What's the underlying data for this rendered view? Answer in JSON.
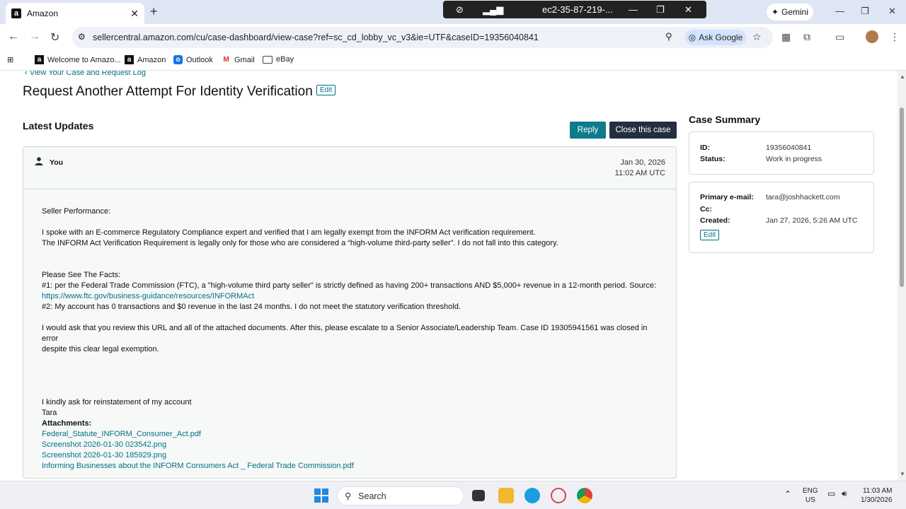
{
  "browser": {
    "tab_title": "Amazon",
    "tab_close": "✕",
    "new_tab": "+",
    "rdp_title": "ec2-35-87-219-...",
    "gemini_label": "Gemini",
    "url": "sellercentral.amazon.com/cu/case-dashboard/view-case?ref=sc_cd_lobby_vc_v3&ie=UTF&caseID=19356040841",
    "ask_google": "Ask Google"
  },
  "bookmarks": [
    {
      "label": "Welcome to Amazo...",
      "icon": "amazon-icon"
    },
    {
      "label": "Amazon",
      "icon": "amazon-icon"
    },
    {
      "label": "Outlook",
      "icon": "outlook-icon"
    },
    {
      "label": "Gmail",
      "icon": "gmail-icon"
    },
    {
      "label": "eBay",
      "icon": "folder-icon"
    }
  ],
  "page": {
    "back_link": "‹ View Your Case and Request Log",
    "title": "Request Another Attempt For Identity Verification",
    "edit_label": "Edit",
    "latest_updates": "Latest Updates",
    "reply_label": "Reply",
    "close_case_label": "Close this case"
  },
  "message": {
    "sender": "You",
    "date": "Jan 30, 2026",
    "time": "11:02 AM UTC",
    "lines": {
      "l1": "Seller Performance:",
      "l2": "I spoke with an E-commerce Regulatory Compliance expert and verified that I am legally exempt from the INFORM Act verification requirement.",
      "l3": "The INFORM Act Verification Requirement is legally only for those who are considered a “high-volume third-party seller”. I do not fall into this category.",
      "l4": "Please See The Facts:",
      "l5": "#1: per the Federal Trade Commission (FTC), a \"high-volume third party seller\" is strictly defined as having 200+ transactions AND $5,000+ revenue in a 12-month period. Source:",
      "l5_link": "https://www.ftc.gov/business-guidance/resources/INFORMAct",
      "l6": "#2: My account has 0 transactions and $0 revenue in the last 24 months. I do not meet the statutory verification threshold.",
      "l7": "I would ask that you review this URL and all of the attached documents. After this, please escalate to a Senior Associate/Leadership Team. Case ID 19305941561 was closed in error",
      "l7b": "despite this clear legal exemption.",
      "l8": "I kindly ask for reinstatement of my account",
      "l9": "Tara"
    },
    "attachments_label": "Attachments:",
    "attachments": [
      "Federal_Statute_INFORM_Consumer_Act.pdf",
      "Screenshot 2026-01-30 023542.png",
      "Screenshot 2026-01-30 185929.png",
      "Informing Businesses about the INFORM Consumers Act _ Federal Trade Commission.pdf"
    ]
  },
  "summary": {
    "title": "Case Summary",
    "id_label": "ID:",
    "id_value": "19356040841",
    "status_label": "Status:",
    "status_value": "Work in progress",
    "email_label": "Primary e-mail:",
    "email_value": "tara@joshhackett.com",
    "cc_label": "Cc:",
    "created_label": "Created:",
    "created_value": "Jan 27, 2026, 5:26 AM UTC",
    "edit_label": "Edit"
  },
  "taskbar": {
    "search_label": "Search",
    "lang1": "ENG",
    "lang2": "US",
    "time": "11:03 AM",
    "date": "1/30/2026"
  },
  "colors": {
    "link": "#007185",
    "reply_button": "#0c7c8c",
    "close_button": "#232f3e"
  }
}
